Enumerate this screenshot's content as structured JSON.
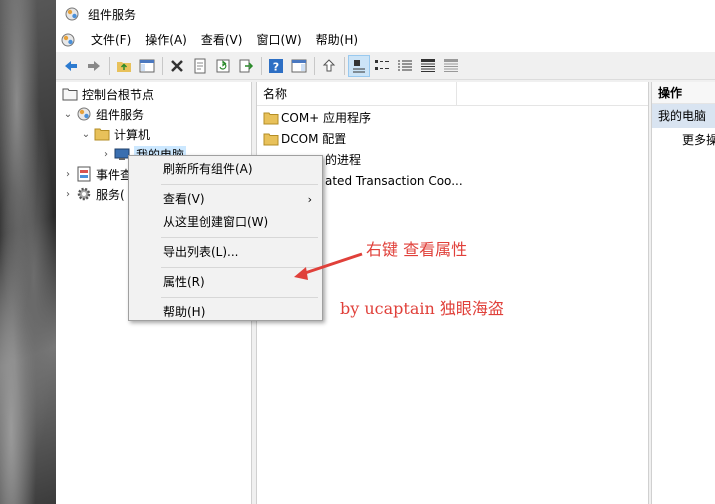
{
  "window": {
    "title": "组件服务"
  },
  "menu": [
    "文件(F)",
    "操作(A)",
    "查看(V)",
    "窗口(W)",
    "帮助(H)"
  ],
  "tree": {
    "root": "控制台根节点",
    "component_services": "组件服务",
    "computers": "计算机",
    "my_computer": "我的电脑",
    "event_viewer": "事件查",
    "services": "服务("
  },
  "list": {
    "header": "名称",
    "items": [
      "COM+ 应用程序",
      "DCOM 配置",
      "的进程",
      "ated Transaction Coo..."
    ]
  },
  "actions": {
    "header": "操作",
    "section": "我的电脑",
    "more": "更多操"
  },
  "context_menu": {
    "refresh": "刷新所有组件(A)",
    "view": "查看(V)",
    "new_window": "从这里创建窗口(W)",
    "export": "导出列表(L)...",
    "properties": "属性(R)",
    "help": "帮助(H)"
  },
  "annotation": {
    "note": "右键 查看属性",
    "author": "by ucaptain 独眼海盗",
    "color": "#e0403a"
  }
}
